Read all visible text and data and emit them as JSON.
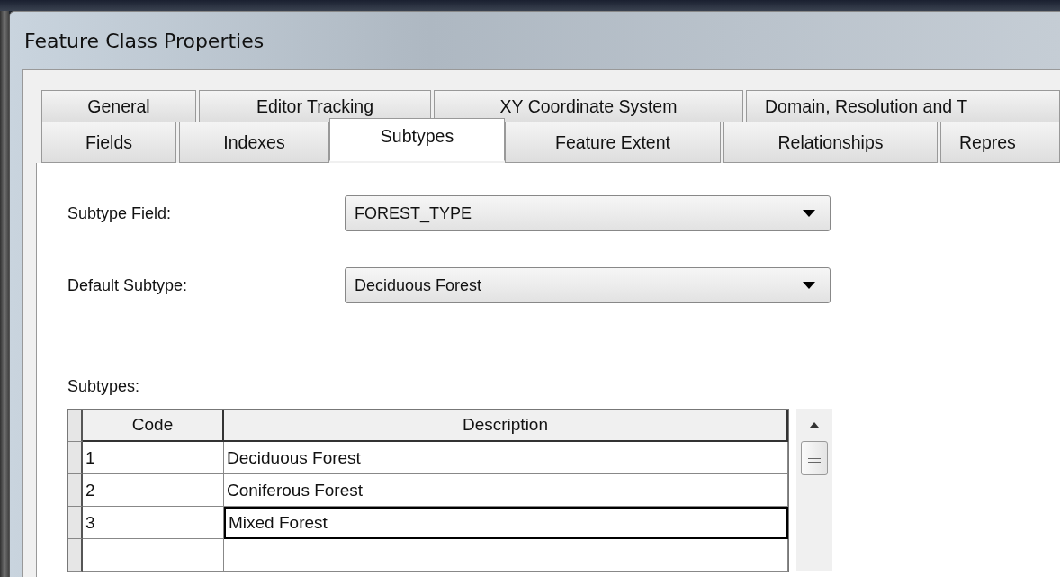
{
  "window": {
    "title": "Feature Class Properties"
  },
  "tab_rows": [
    [
      {
        "label": "General",
        "selected": false
      },
      {
        "label": "Editor Tracking",
        "selected": false
      },
      {
        "label": "XY Coordinate System",
        "selected": false
      },
      {
        "label": "Domain, Resolution and T",
        "selected": false
      }
    ],
    [
      {
        "label": "Fields",
        "selected": false
      },
      {
        "label": "Indexes",
        "selected": false
      },
      {
        "label": "Subtypes",
        "selected": true
      },
      {
        "label": "Feature Extent",
        "selected": false
      },
      {
        "label": "Relationships",
        "selected": false
      },
      {
        "label": "Repres",
        "selected": false
      }
    ]
  ],
  "subtype_field": {
    "label": "Subtype Field:",
    "value": "FOREST_TYPE"
  },
  "default_subtype": {
    "label": "Default Subtype:",
    "value": "Deciduous Forest"
  },
  "subtypes_table": {
    "label": "Subtypes:",
    "columns": [
      "Code",
      "Description"
    ],
    "rows": [
      {
        "code": "1",
        "description": "Deciduous Forest",
        "selected": false
      },
      {
        "code": "2",
        "description": "Coniferous Forest",
        "selected": false
      },
      {
        "code": "3",
        "description": "Mixed Forest",
        "selected": true
      },
      {
        "code": "",
        "description": "",
        "selected": false
      }
    ]
  }
}
